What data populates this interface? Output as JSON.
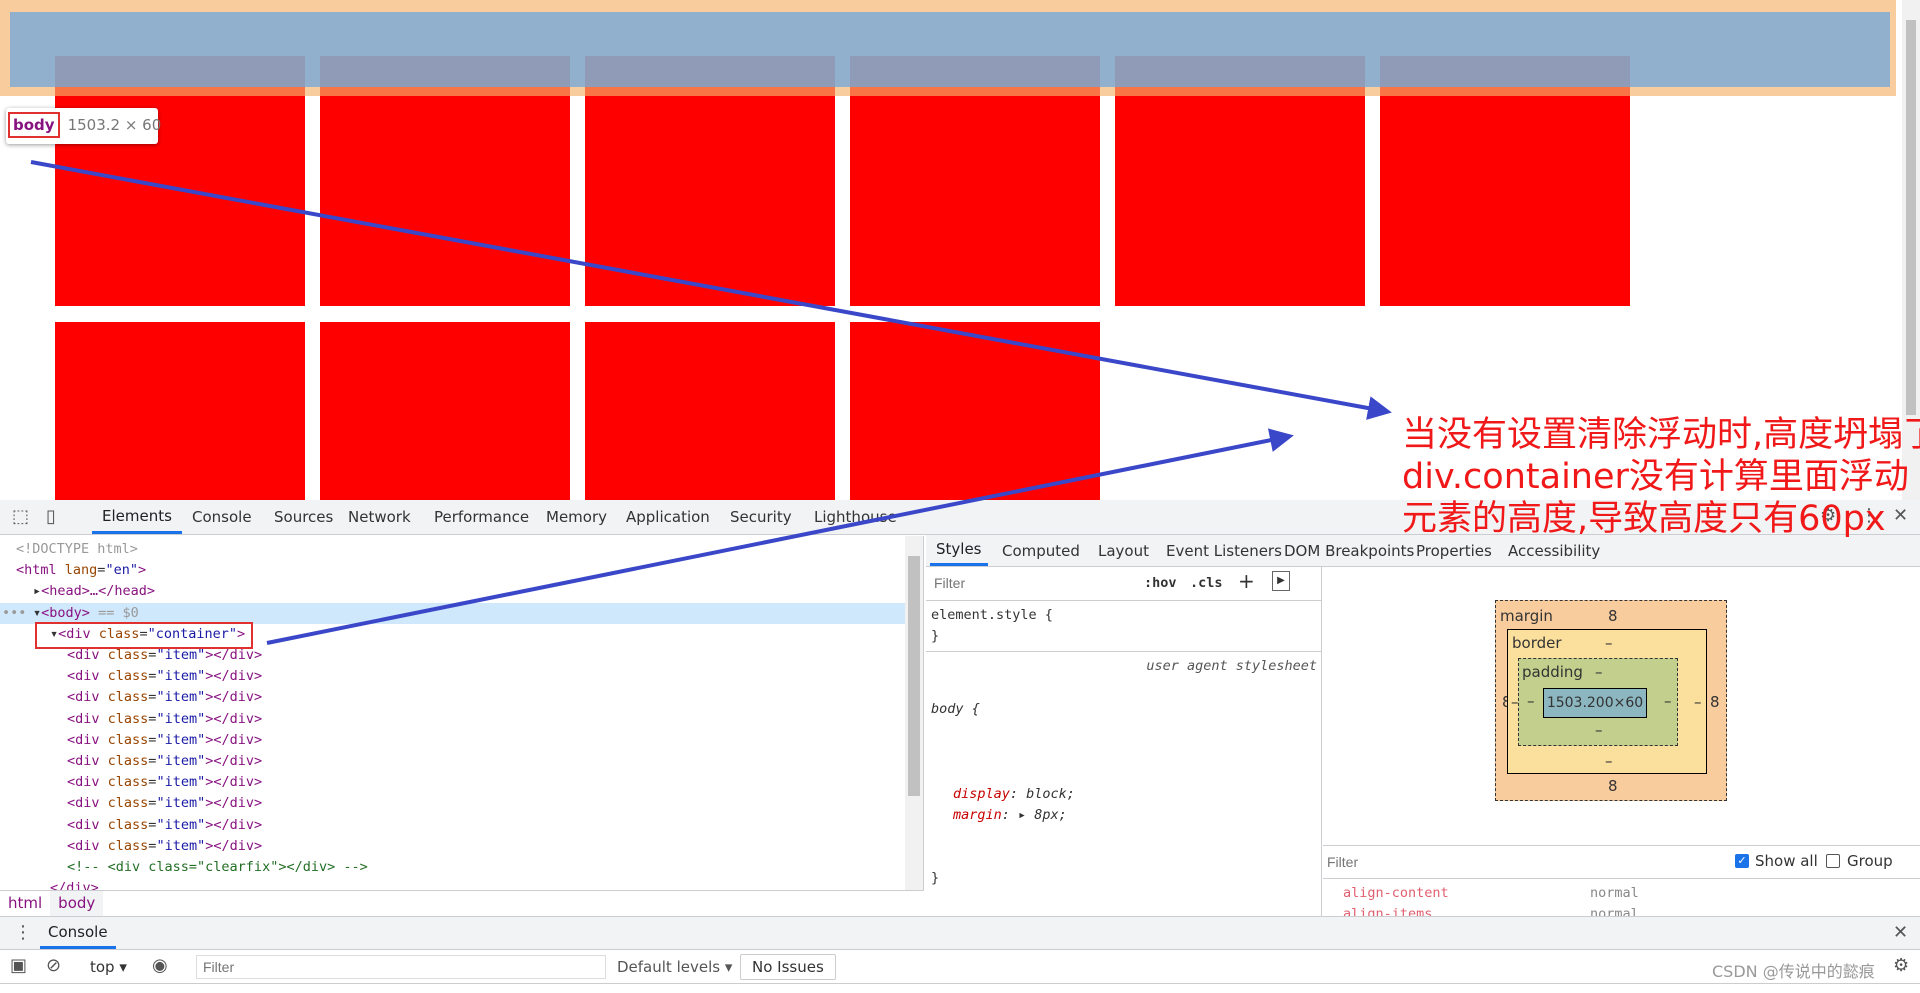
{
  "page": {
    "item_count_row1": 6,
    "item_count_row2": 4,
    "colors": {
      "item": "#ff0000",
      "highlight_margin": "#f6b26b",
      "highlight_content": "#6fa8dc"
    }
  },
  "tooltip": {
    "tag": "body",
    "dimensions": "1503.2 × 60"
  },
  "annotation": {
    "lines": [
      "当没有设置清除浮动时,高度坍塌了.",
      "div.container没有计算里面浮动",
      "元素的高度,导致高度只有60px"
    ],
    "color": "#f01818"
  },
  "devtools": {
    "tabs": [
      "Elements",
      "Console",
      "Sources",
      "Network",
      "Performance",
      "Memory",
      "Application",
      "Security",
      "Lighthouse"
    ],
    "active_tab": "Elements",
    "dom": [
      {
        "t": "<!DOCTYPE html>"
      },
      {
        "t": "<html lang=\"en\">"
      },
      {
        "t": "<head>…</head>"
      },
      {
        "t": "<body> == $0"
      },
      {
        "t": "<div class=\"container\">"
      },
      {
        "t": "<div class=\"item\"></div>"
      },
      {
        "t": "<div class=\"item\"></div>"
      },
      {
        "t": "<div class=\"item\"></div>"
      },
      {
        "t": "<div class=\"item\"></div>"
      },
      {
        "t": "<div class=\"item\"></div>"
      },
      {
        "t": "<div class=\"item\"></div>"
      },
      {
        "t": "<div class=\"item\"></div>"
      },
      {
        "t": "<div class=\"item\"></div>"
      },
      {
        "t": "<div class=\"item\"></div>"
      },
      {
        "t": "<div class=\"item\"></div>"
      },
      {
        "t": "<!-- <div class=\"clearfix\"></div> -->"
      },
      {
        "t": "</div>"
      }
    ],
    "breadcrumbs": [
      "html",
      "body"
    ],
    "sidebar_tabs": [
      "Styles",
      "Computed",
      "Layout",
      "Event Listeners",
      "DOM Breakpoints",
      "Properties",
      "Accessibility"
    ],
    "styles": {
      "filter_placeholder": "Filter",
      "hov": ":hov",
      "cls": ".cls",
      "element_style": "element.style {",
      "close_brace": "}",
      "rule_selector": "body {",
      "rule_source": "user agent stylesheet",
      "props": [
        {
          "name": "display",
          "value": "block;"
        },
        {
          "name": "margin",
          "value": "8px;"
        }
      ]
    },
    "box_model": {
      "margin_label": "margin",
      "border_label": "border",
      "padding_label": "padding",
      "margin_top": "8",
      "margin_bottom": "8",
      "margin_left": "8",
      "margin_right": "8",
      "border": "–",
      "padding": "–",
      "content": "1503.200×60"
    },
    "computed": {
      "filter_placeholder": "Filter",
      "show_all": "Show all",
      "show_all_checked": true,
      "group": "Group",
      "group_checked": false,
      "props": [
        {
          "name": "align-content",
          "value": "normal"
        },
        {
          "name": "align-items",
          "value": "normal"
        }
      ]
    },
    "drawer": {
      "tab": "Console",
      "context": "top",
      "filter_placeholder": "Filter",
      "levels": "Default levels",
      "issues": "No Issues"
    }
  },
  "watermark": "CSDN @传说中的懿痕"
}
